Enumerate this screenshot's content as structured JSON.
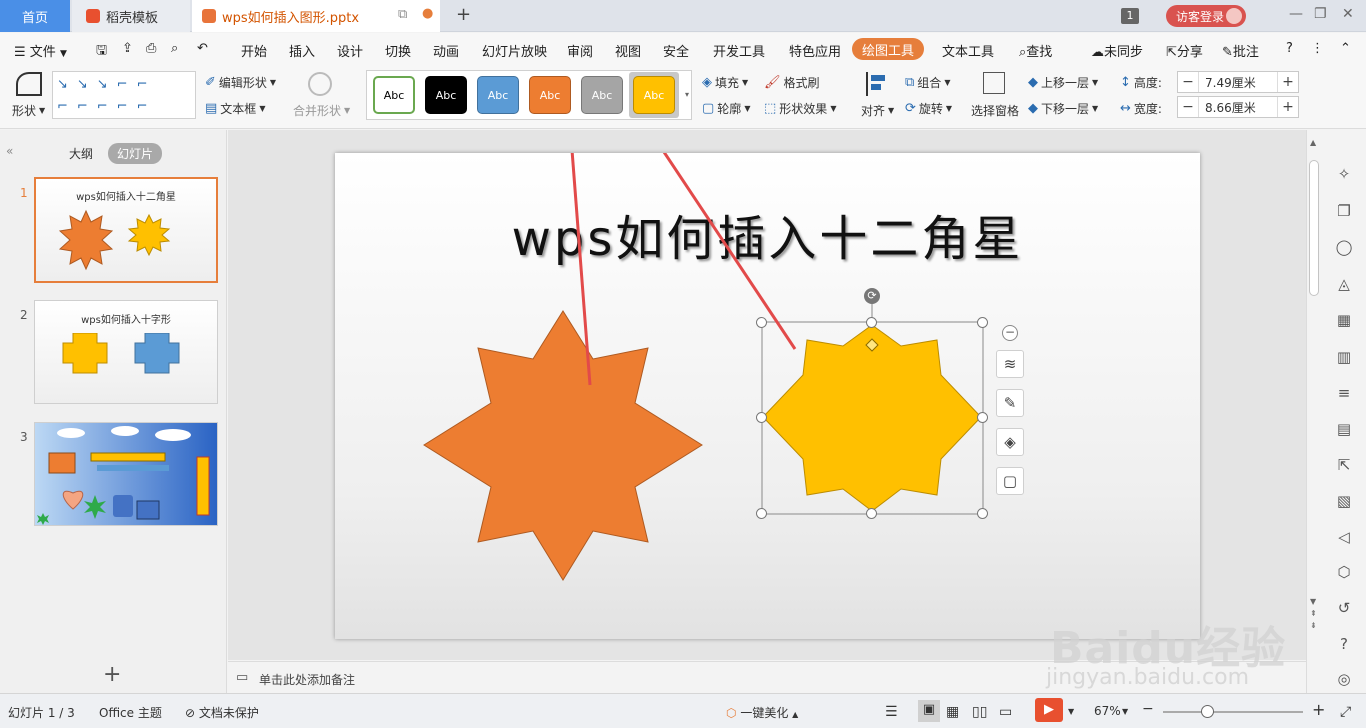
{
  "tabs": {
    "home": "首页",
    "template": "稻壳模板",
    "doc": "wps如何插入图形.pptx",
    "badge": "1",
    "login": "访客登录"
  },
  "menu": {
    "file": "文件",
    "items": [
      "开始",
      "插入",
      "设计",
      "切换",
      "动画",
      "幻灯片放映",
      "审阅",
      "视图",
      "安全",
      "开发工具",
      "特色应用",
      "绘图工具",
      "文本工具"
    ],
    "search": "查找",
    "sync": "未同步",
    "share": "分享",
    "comment": "批注",
    "help": "?"
  },
  "ribbon": {
    "shape": "形状",
    "edit_shape": "编辑形状",
    "textbox": "文本框",
    "merge_shape": "合并形状",
    "styles": [
      "Abc",
      "Abc",
      "Abc",
      "Abc",
      "Abc",
      "Abc"
    ],
    "fill": "填充",
    "outline": "轮廓",
    "format_brush": "格式刷",
    "shape_effect": "形状效果",
    "align": "对齐",
    "group": "组合",
    "rotate": "旋转",
    "selection_pane": "选择窗格",
    "bring_forward": "上移一层",
    "send_backward": "下移一层",
    "height_label": "高度:",
    "height_value": "7.49厘米",
    "width_label": "宽度:",
    "width_value": "8.66厘米"
  },
  "colors": {
    "accent": "#e67e3b",
    "orange_star": "#ed7d31",
    "yellow_star": "#ffc000",
    "blue_shape": "#5b9bd5",
    "tab_blue": "#4a8fe7"
  },
  "panel": {
    "outline_tab": "大纲",
    "slides_tab": "幻灯片",
    "slides": [
      {
        "num": "1",
        "title": "wps如何插入十二角星"
      },
      {
        "num": "2",
        "title": "wps如何插入十字形"
      },
      {
        "num": "3",
        "title": ""
      }
    ]
  },
  "slide": {
    "title": "wps如何插入十二角星"
  },
  "notes": {
    "placeholder": "单击此处添加备注"
  },
  "status": {
    "slide_index": "幻灯片 1 / 3",
    "theme": "Office 主题",
    "protection": "文档未保护",
    "beautify": "一键美化",
    "zoom": "67%"
  },
  "watermark": {
    "brand": "Baidu经验",
    "url": "jingyan.baidu.com"
  }
}
